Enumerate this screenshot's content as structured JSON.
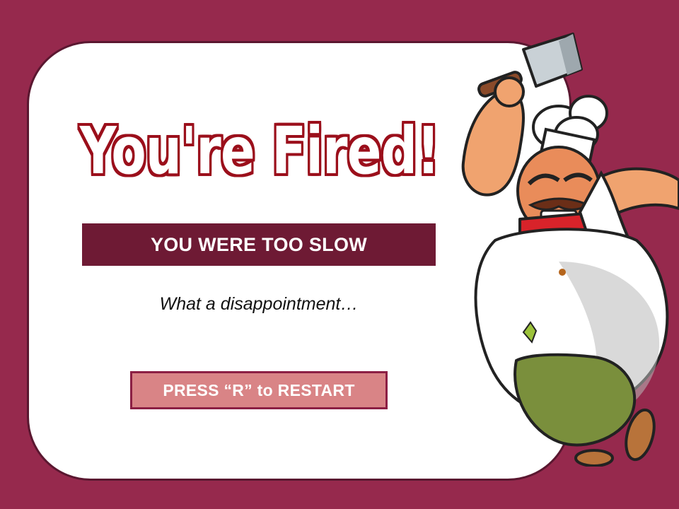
{
  "screen": {
    "title": "You're Fired!",
    "banner": "YOU WERE TOO SLOW",
    "subtitle": "What a disappointment…",
    "restart_label": "PRESS “R” to RESTART"
  },
  "illustration": {
    "name": "angry-chef-with-cleaver"
  },
  "colors": {
    "background": "#96294d",
    "card": "#ffffff",
    "banner": "#6e1a34",
    "title_outline": "#9b0f1b",
    "button_fill": "#d98486",
    "button_border": "#8c1f44"
  }
}
